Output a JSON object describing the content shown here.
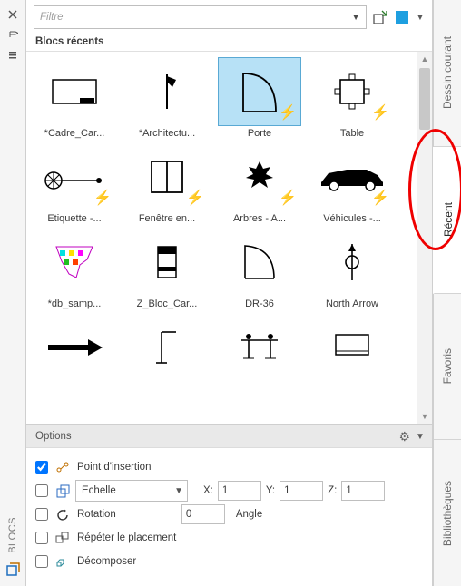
{
  "panel_title": "BLOCS",
  "filter_placeholder": "Filtre",
  "section_label": "Blocs récents",
  "blocks": [
    {
      "label": "*Cadre_Car...",
      "bolt": false
    },
    {
      "label": "*Architectu...",
      "bolt": false
    },
    {
      "label": "Porte",
      "bolt": true,
      "selected": true
    },
    {
      "label": "Table",
      "bolt": true
    },
    {
      "label": "Etiquette -...",
      "bolt": true
    },
    {
      "label": "Fenêtre en...",
      "bolt": true
    },
    {
      "label": "Arbres - A...",
      "bolt": true
    },
    {
      "label": "Véhicules -...",
      "bolt": true
    },
    {
      "label": "*db_samp...",
      "bolt": false
    },
    {
      "label": "Z_Bloc_Car...",
      "bolt": false
    },
    {
      "label": "DR-36",
      "bolt": false
    },
    {
      "label": "North Arrow",
      "bolt": false
    },
    {
      "label": "",
      "bolt": false
    },
    {
      "label": "",
      "bolt": false
    },
    {
      "label": "",
      "bolt": false
    },
    {
      "label": "",
      "bolt": false
    }
  ],
  "options_label": "Options",
  "opt_insertion": {
    "label": "Point d'insertion",
    "checked": true
  },
  "opt_scale": {
    "label": "Echelle",
    "checked": false,
    "X": "X:",
    "Y": "Y:",
    "Z": "Z:",
    "xv": "1",
    "yv": "1",
    "zv": "1"
  },
  "opt_rotation": {
    "label": "Rotation",
    "checked": false,
    "value": "0",
    "angle_label": "Angle"
  },
  "opt_repeat": {
    "label": "Répéter le placement",
    "checked": false
  },
  "opt_explode": {
    "label": "Décomposer",
    "checked": false
  },
  "tabs": [
    {
      "label": "Dessin courant",
      "active": false
    },
    {
      "label": "Récent",
      "active": true
    },
    {
      "label": "Favoris",
      "active": false
    },
    {
      "label": "Bibliothèques",
      "active": false
    }
  ]
}
